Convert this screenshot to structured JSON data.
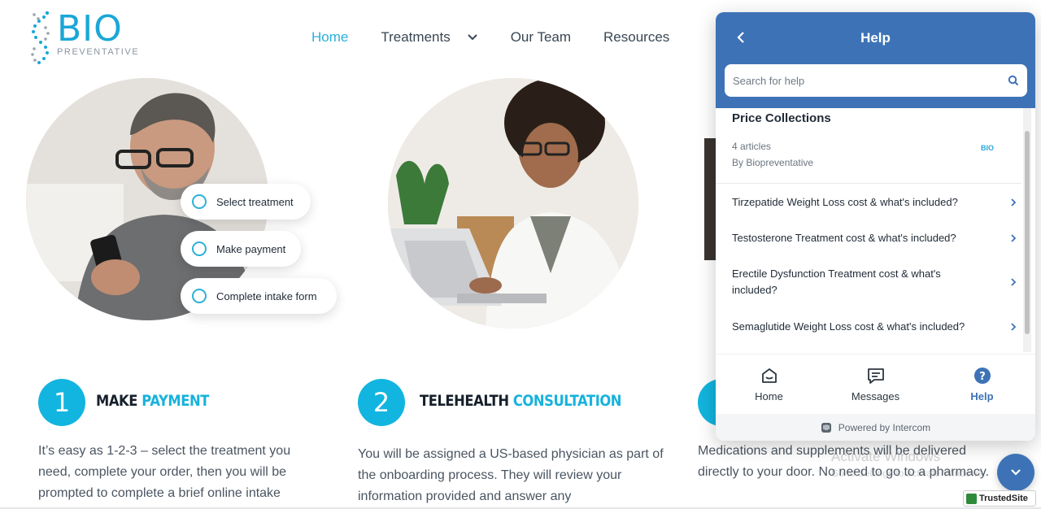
{
  "brand": {
    "name": "BIO",
    "tagline": "PREVENTATIVE",
    "color": "#1aa7d7"
  },
  "nav": {
    "items": [
      {
        "label": "Home",
        "active": true
      },
      {
        "label": "Treatments",
        "has_dropdown": true
      },
      {
        "label": "Our Team"
      },
      {
        "label": "Resources"
      }
    ]
  },
  "hero": {
    "checklist": [
      "Select treatment",
      "Make payment",
      "Complete intake form"
    ]
  },
  "steps": [
    {
      "number": "1",
      "title_a": "MAKE",
      "title_b": "PAYMENT",
      "text": "It’s easy as 1-2-3 – select the treatment you need, complete your order, then you will be prompted to complete a brief online intake"
    },
    {
      "number": "2",
      "title_a": "TELEHEALTH",
      "title_b": "CONSULTATION",
      "text": "You will be assigned a US-based physician as part of the onboarding process. They will review your information provided and answer any"
    },
    {
      "text": "Medications and supplements will be delivered directly to your door. No need to go to a pharmacy."
    }
  ],
  "help_widget": {
    "title": "Help",
    "search_placeholder": "Search for help",
    "collection": {
      "title": "Price Collections",
      "count": "4 articles",
      "author": "By Biopreventative",
      "logo_text": "BIO"
    },
    "articles": [
      "Tirzepatide Weight Loss cost & what's included?",
      "Testosterone Treatment cost & what's included?",
      "Erectile Dysfunction Treatment cost & what's included?",
      "Semaglutide Weight Loss cost & what's included?"
    ],
    "tabs": [
      {
        "label": "Home",
        "icon": "home-icon"
      },
      {
        "label": "Messages",
        "icon": "messages-icon"
      },
      {
        "label": "Help",
        "icon": "help-icon",
        "active": true
      }
    ],
    "footer": "Powered by Intercom",
    "accent": "#3d73b6"
  },
  "watermark": {
    "line1": "Activate Windows",
    "line2": "Go to Settings to activate Windows."
  },
  "badge": {
    "label": "TrustedSite"
  }
}
